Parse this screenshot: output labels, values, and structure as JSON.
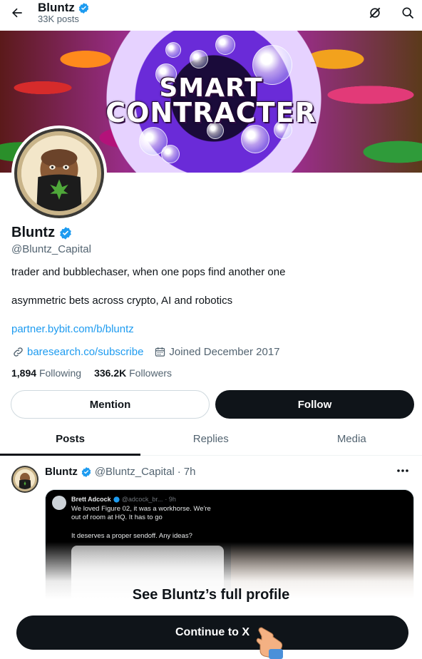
{
  "header": {
    "name": "Bluntz",
    "posts_count": "33K posts"
  },
  "banner": {
    "line1": "SMART",
    "line2": "CONTRACTER"
  },
  "profile": {
    "name": "Bluntz",
    "handle": "@Bluntz_Capital",
    "bio_line1": "trader and bubblechaser, when one pops find another one",
    "bio_line2": "asymmetric bets across crypto, AI and robotics",
    "bio_link": "partner.bybit.com/b/bluntz",
    "website": "baresearch.co/subscribe",
    "joined": "Joined December 2017",
    "following_count": "1,894",
    "following_label": "Following",
    "followers_count": "336.2K",
    "followers_label": "Followers"
  },
  "actions": {
    "mention_label": "Mention",
    "follow_label": "Follow"
  },
  "tabs": [
    {
      "label": "Posts",
      "active": true
    },
    {
      "label": "Replies",
      "active": false
    },
    {
      "label": "Media",
      "active": false
    }
  ],
  "post": {
    "author_name": "Bluntz",
    "author_handle": "@Bluntz_Capital",
    "separator": "·",
    "time": "7h",
    "quoted": {
      "author_name": "Brett Adcock",
      "author_handle": "@adcock_br...",
      "time": "· 9h",
      "text": "We loved Figure 02, it was a workhorse. We're out of room at HQ. It has to go",
      "text2": "It deserves a proper sendoff. Any ideas?"
    }
  },
  "cta": {
    "title": "See Bluntz’s full profile",
    "button_label": "Continue to X"
  },
  "colors": {
    "accent": "#1d9bf0",
    "text_primary": "#0f1419",
    "text_secondary": "#536471",
    "button_dark": "#0f1419",
    "verified": "#1d9bf0"
  },
  "icons": {
    "back": "arrow-left-icon",
    "grok": "grok-icon",
    "search": "search-icon",
    "verified": "verified-badge-icon",
    "link": "link-icon",
    "calendar": "calendar-icon",
    "more": "more-dots-icon"
  }
}
